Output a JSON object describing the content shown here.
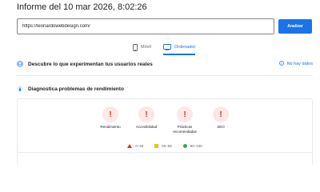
{
  "report": {
    "title": "Informe del 10 mar 2026, 8:02:26"
  },
  "search": {
    "url": "https://leonardowebdesign.com/",
    "analyze_label": "Analizar"
  },
  "tabs": [
    {
      "label": "Móvil",
      "icon": "smartphone-icon",
      "active": false
    },
    {
      "label": "Ordenador",
      "icon": "desktop-icon",
      "active": true
    }
  ],
  "sections": {
    "field_data": {
      "title": "Descubre lo que experimentan tus usuarios reales",
      "status": "No hay datos",
      "icon": "people-icon"
    },
    "diagnose": {
      "title": "Diagnostica problemas de rendimiento",
      "icon": "lighthouse-icon"
    }
  },
  "metrics": [
    {
      "label": "Rendimiento",
      "value": "!",
      "status": "error"
    },
    {
      "label": "Accesibilidad",
      "value": "!",
      "status": "error"
    },
    {
      "label": "Prácticas recomendadas",
      "value": "!",
      "status": "error"
    },
    {
      "label": "SEO",
      "value": "!",
      "status": "error"
    }
  ],
  "legend": [
    {
      "range": "0–49",
      "shape": "triangle",
      "color": "#d93025"
    },
    {
      "range": "50–89",
      "shape": "square",
      "color": "#fbbc04"
    },
    {
      "range": "90–100",
      "shape": "circle",
      "color": "#34a853"
    }
  ],
  "colors": {
    "accent": "#1a73e8",
    "error": "#d93025",
    "error_bg": "#fce8e6"
  }
}
